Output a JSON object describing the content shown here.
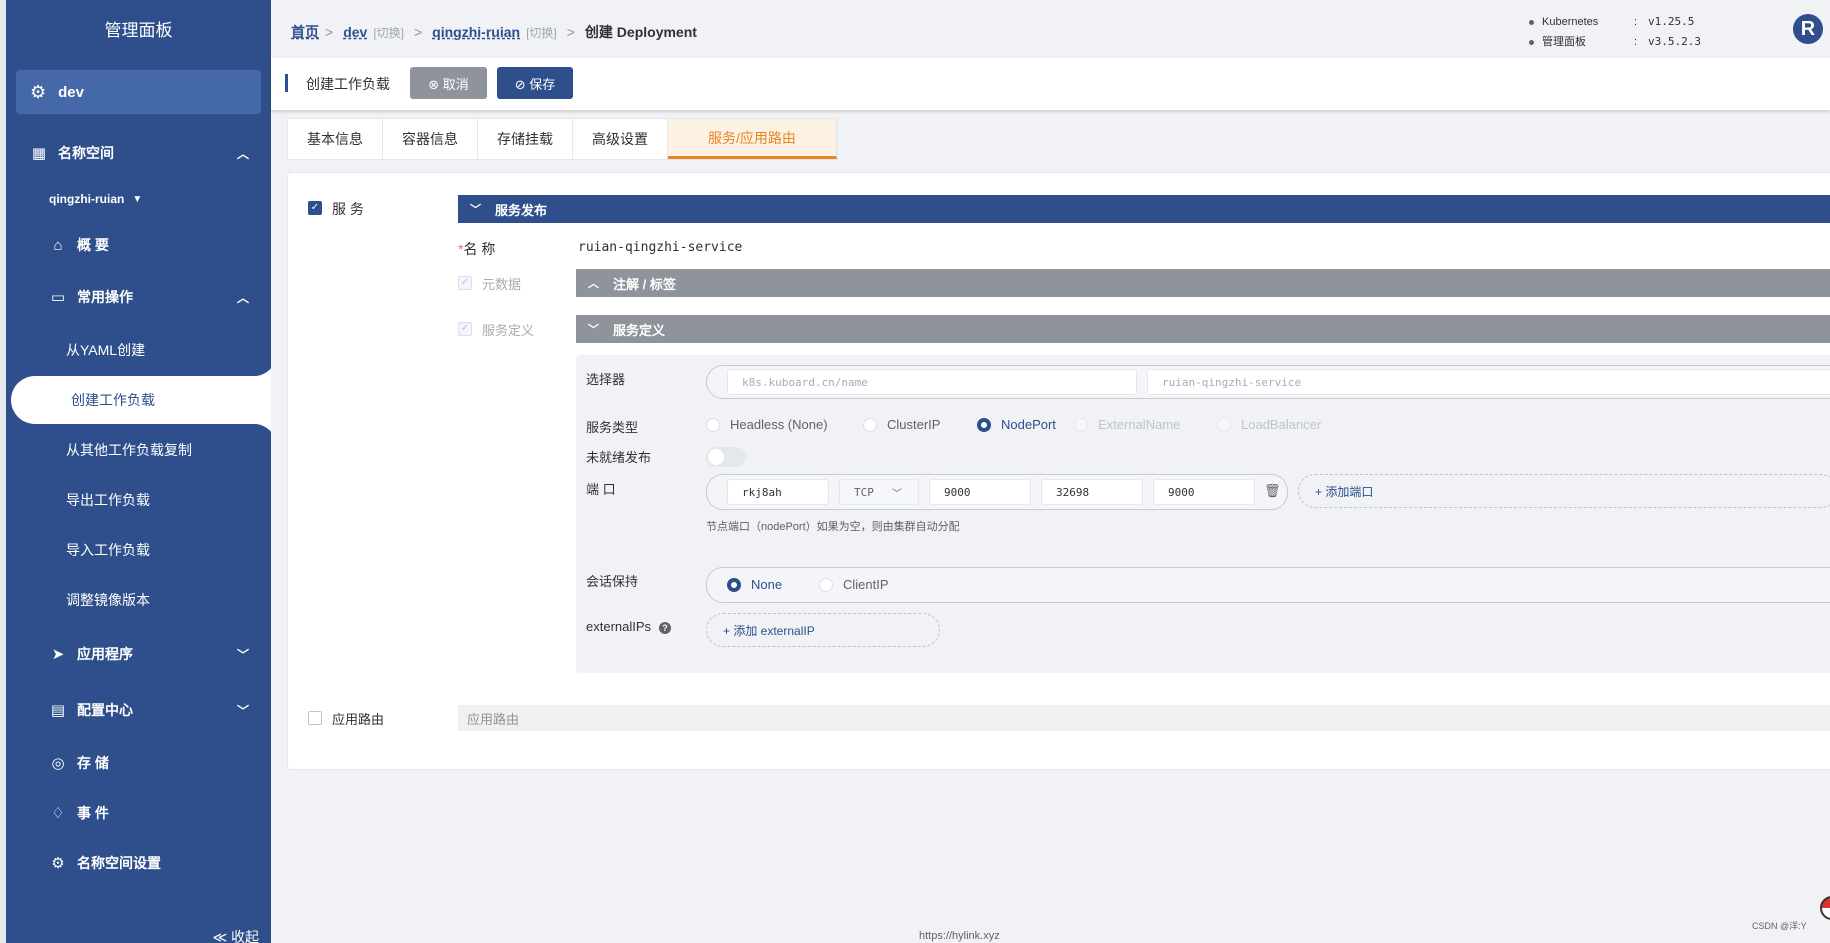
{
  "sidebar": {
    "title": "管理面板",
    "cluster": "dev",
    "namespace_label": "名称空间",
    "namespace": "qingzhi-ruian",
    "overview": "概 要",
    "common_ops": "常用操作",
    "items": [
      "从YAML创建",
      "创建工作负载",
      "从其他工作负载复制",
      "导出工作负载",
      "导入工作负载",
      "调整镜像版本"
    ],
    "apps": "应用程序",
    "config": "配置中心",
    "storage": "存 储",
    "events": "事 件",
    "ns_settings": "名称空间设置",
    "collapse": "≪ 收起"
  },
  "breadcrumb": {
    "home": "首页",
    "cluster": "dev",
    "switch1": "[切换]",
    "namespace": "qingzhi-ruian",
    "switch2": "[切换]",
    "current": "创建 Deployment"
  },
  "versions": [
    {
      "key": "Kubernetes",
      "value": "v1.25.5"
    },
    {
      "key": "管理面板",
      "value": "v3.5.2.3"
    }
  ],
  "logo": "R",
  "toolbar": {
    "title": "创建工作负载",
    "cancel": "⊗ 取消",
    "save": "⊘ 保存"
  },
  "tabs": [
    "基本信息",
    "容器信息",
    "存储挂载",
    "高级设置",
    "服务/应用路由"
  ],
  "service": {
    "checkbox_label": "服 务",
    "section_title": "服务发布",
    "name_label": "名 称",
    "name_required": "*",
    "name_value": "ruian-qingzhi-service",
    "meta_label": "元数据",
    "meta_section": "注解 / 标签",
    "def_label": "服务定义",
    "def_section": "服务定义",
    "selector_label": "选择器",
    "selector_key_placeholder": "k8s.kuboard.cn/name",
    "selector_value_placeholder": "ruian-qingzhi-service",
    "type_label": "服务类型",
    "types": [
      "Headless (None)",
      "ClusterIP",
      "NodePort",
      "ExternalName",
      "LoadBalancer"
    ],
    "unready_label": "未就绪发布",
    "port_label": "端 口",
    "port": {
      "name": "rkj8ah",
      "protocol": "TCP",
      "port": "9000",
      "node_port": "32698",
      "target_port": "9000"
    },
    "add_port": "+ 添加端口",
    "port_hint": "节点端口（nodePort）如果为空，则由集群自动分配",
    "session_label": "会话保持",
    "session_options": [
      "None",
      "ClientIP"
    ],
    "external_label": "externalIPs",
    "add_external": "+ 添加 externalIP"
  },
  "route": {
    "checkbox_label": "应用路由",
    "bar": "应用路由"
  },
  "footer": "https://hylink.xyz",
  "watermark": "CSDN @洋:Y"
}
